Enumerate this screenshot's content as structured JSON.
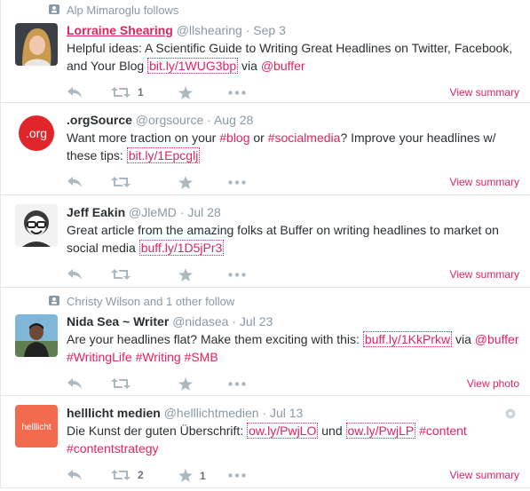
{
  "tweets": [
    {
      "context": "Alp Mimaroglu follows",
      "name": "Lorraine Shearing",
      "handle": "@llshearing",
      "date": "Sep 3",
      "text_parts": [
        "Helpful ideas: A Scientific Guide to Writing Great Headlines on Twitter, Facebook, and Your Blog",
        "bit.ly/1WUG3bp",
        "via",
        "@buffer"
      ],
      "retweets": "1",
      "favorites": "",
      "action_link": "View summary"
    },
    {
      "context": "",
      "name": ".orgSource",
      "handle": "@orgsource",
      "date": "Aug 28",
      "text_parts": [
        "Want more traction on your",
        "#blog",
        "or",
        "#socialmedia",
        "? Improve your headlines w/ these tips:",
        "bit.ly/1Epcglj"
      ],
      "retweets": "",
      "favorites": "",
      "action_link": "View summary",
      "avatar_text": ".org"
    },
    {
      "context": "",
      "name": "Jeff Eakin",
      "handle": "@JleMD",
      "date": "Jul 28",
      "text_parts": [
        "Great article from the amazing folks at Buffer on writing headlines to market on social media",
        "buff.ly/1D5jPr3"
      ],
      "retweets": "",
      "favorites": "",
      "action_link": "View summary"
    },
    {
      "context": "Christy Wilson and 1 other follow",
      "name": "Nida Sea ~ Writer",
      "handle": "@nidasea",
      "date": "Jul 23",
      "text_parts": [
        "Are your headlines flat? Make them exciting with this:",
        "buff.ly/1KkPrkw",
        "via",
        "@buffer",
        "#WritingLife",
        "#Writing",
        "#SMB"
      ],
      "retweets": "",
      "favorites": "",
      "action_link": "View photo"
    },
    {
      "context": "",
      "name": "helllicht medien",
      "handle": "@helllichtmedien",
      "date": "Jul 13",
      "text_parts": [
        "Die Kunst der guten Überschrift:",
        "ow.ly/PwjLO",
        "und",
        "ow.ly/PwjLP",
        "#content",
        "#contentstrategy"
      ],
      "retweets": "2",
      "favorites": "1",
      "action_link": "View summary",
      "avatar_text": "helllicht"
    }
  ],
  "colors": {
    "accent": "#e0245e",
    "muted": "#8899a6",
    "text": "#292f33",
    "border": "#e1e8ed"
  },
  "icons": [
    "reply-icon",
    "retweet-icon",
    "favorite-star-icon",
    "more-dots-icon",
    "follow-context-icon",
    "globe-icon"
  ]
}
